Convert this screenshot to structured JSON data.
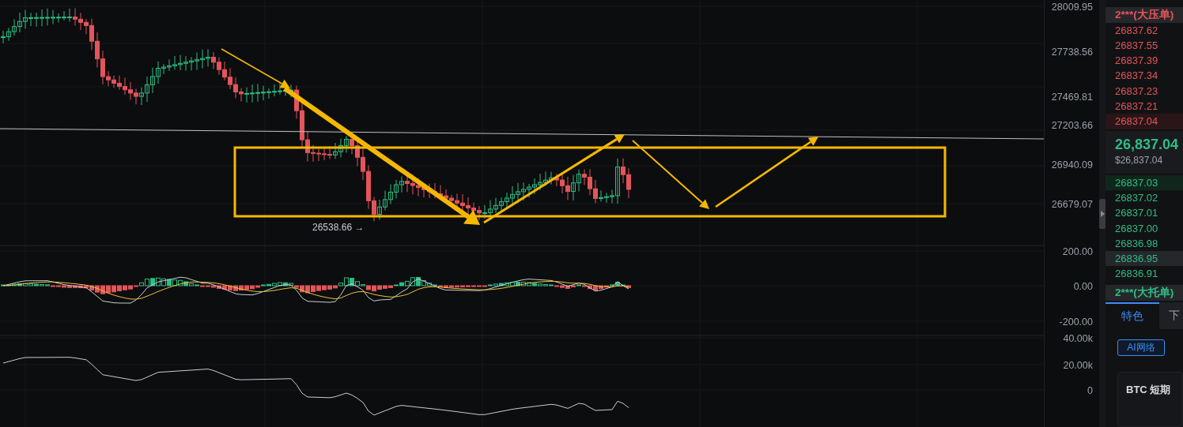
{
  "price_axis": [
    "28009.95",
    "27738.56",
    "27469.81",
    "27203.66",
    "26940.09",
    "26679.07"
  ],
  "low_marker": "26538.66 →",
  "macd_axis": [
    "200.00",
    "0.00",
    "-200.00"
  ],
  "volume_axis": [
    "40.00k",
    "20.00k",
    "0"
  ],
  "order_book": {
    "ask_label": "2***(大压单)",
    "asks": [
      {
        "price": "26837.62",
        "highlighted": false
      },
      {
        "price": "26837.55",
        "highlighted": false
      },
      {
        "price": "26837.39",
        "highlighted": false
      },
      {
        "price": "26837.34",
        "highlighted": false
      },
      {
        "price": "26837.23",
        "highlighted": false
      },
      {
        "price": "26837.21",
        "highlighted": false
      },
      {
        "price": "26837.04",
        "highlighted": true
      }
    ],
    "last_price": "26,837.04",
    "last_price_usd": "$26,837.04",
    "bids": [
      {
        "price": "26837.03",
        "highlighted": true
      },
      {
        "price": "26837.02",
        "highlighted": false
      },
      {
        "price": "26837.01",
        "highlighted": false
      },
      {
        "price": "26837.00",
        "highlighted": false
      },
      {
        "price": "26836.98",
        "highlighted": false
      },
      {
        "price": "26836.95",
        "highlighted": true
      },
      {
        "price": "26836.91",
        "highlighted": false
      }
    ],
    "bid_label": "2***(大托单)"
  },
  "tabs": [
    {
      "label": "特色",
      "selected": true
    },
    {
      "label": "下",
      "selected": false
    }
  ],
  "filter_button": "AI网络",
  "card_title": "BTC 短期"
}
